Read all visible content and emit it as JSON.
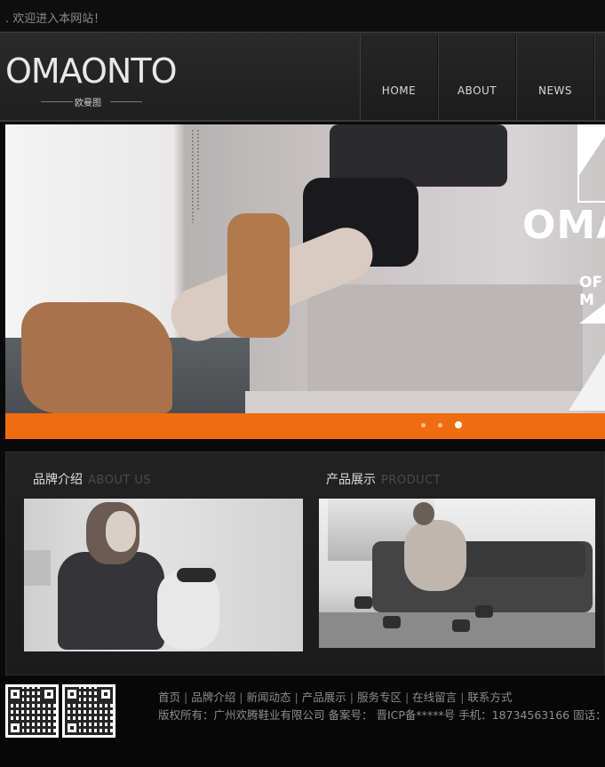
{
  "topbar": {
    "welcome": ". 欢迎进入本网站！"
  },
  "header": {
    "logo_text": "OMAONTO",
    "logo_sub": "欧曼图",
    "nav": [
      {
        "label": "HOME"
      },
      {
        "label": "ABOUT"
      },
      {
        "label": "NEWS"
      }
    ]
  },
  "banner": {
    "brand_text": "OMAC",
    "of_text": "OF M",
    "slides": 3,
    "active_slide": 3,
    "accent_color": "#f06c10"
  },
  "sections": {
    "about": {
      "title": "品牌介绍",
      "subtitle": "ABOUT US"
    },
    "product": {
      "title": "产品展示",
      "subtitle": "PRODUCT"
    }
  },
  "footer": {
    "links": [
      "首页",
      "品牌介绍",
      "新闻动态",
      "产品展示",
      "服务专区",
      "在线留言",
      "联系方式"
    ],
    "separator": "|",
    "copyright": "版权所有：广州欢腾鞋业有限公司 备案号： 晋ICP备*****号 手机：18734563166 固话："
  }
}
